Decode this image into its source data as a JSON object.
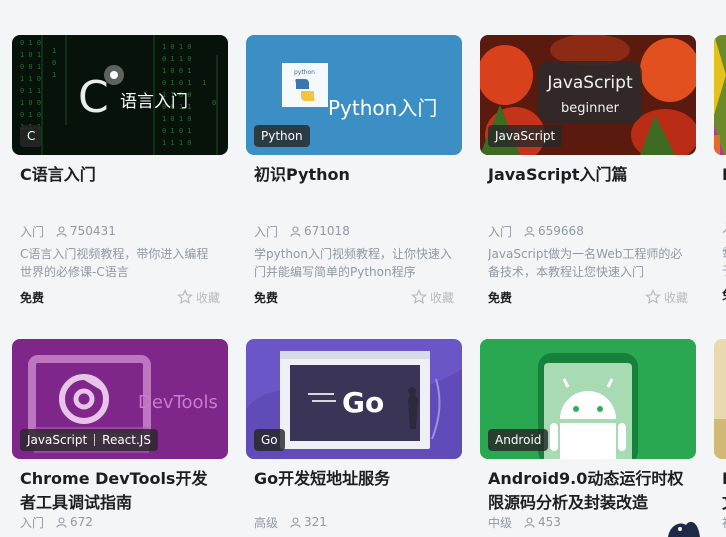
{
  "cards": [
    {
      "tag": "C",
      "title": "C语言入门",
      "level": "入门",
      "students": "750431",
      "desc": "C语言入门视频教程，带你进入编程世界的必修课-C语言",
      "price": "免费",
      "fav": "收藏",
      "thumb_text": "语言入门",
      "thumb_letter": "C",
      "colors": {
        "bg": "#0a140c",
        "rain": "#3fbf4a"
      }
    },
    {
      "tag": "Python",
      "title": "初识Python",
      "level": "入门",
      "students": "671018",
      "desc": "学python入门视频教程，让你快速入门并能编写简单的Python程序",
      "price": "免费",
      "fav": "收藏",
      "thumb_text": "Python入门",
      "thumb_logo_text": "python",
      "colors": {
        "bg": "#3b8fc4"
      }
    },
    {
      "tag": "JavaScript",
      "title": "JavaScript入门篇",
      "level": "入门",
      "students": "659668",
      "desc": "JavaScript做为一名Web工程师的必备技术，本教程让您快速入门",
      "price": "免费",
      "fav": "收藏",
      "thumb_text": "JavaScript",
      "thumb_sub": "beginner",
      "colors": {
        "bg": "#7a1f10"
      }
    },
    {
      "tags": [
        "JavaScript",
        "React.JS"
      ],
      "title": "Chrome DevTools开发者工具调试指南",
      "level": "入门",
      "students": "672",
      "thumb_text": "DevTools",
      "colors": {
        "bg": "#8b2a92"
      }
    },
    {
      "tag": "Go",
      "title": "Go开发短地址服务",
      "level": "高级",
      "students": "321",
      "thumb_text": "Go",
      "colors": {
        "bg": "#6b56c8"
      }
    },
    {
      "tag": "Android",
      "title": "Android9.0动态运行时权限源码分析及封装改造",
      "level": "中级",
      "students": "453",
      "colors": {
        "bg": "#2fae55"
      }
    }
  ],
  "partial_right": {
    "row1_title": "F",
    "row1_meta": "入",
    "row1_desc1": "翥",
    "row1_desc2": "于",
    "row1_price": "免",
    "row2_title1": "F",
    "row2_title2": "文",
    "row2_meta": "初"
  }
}
